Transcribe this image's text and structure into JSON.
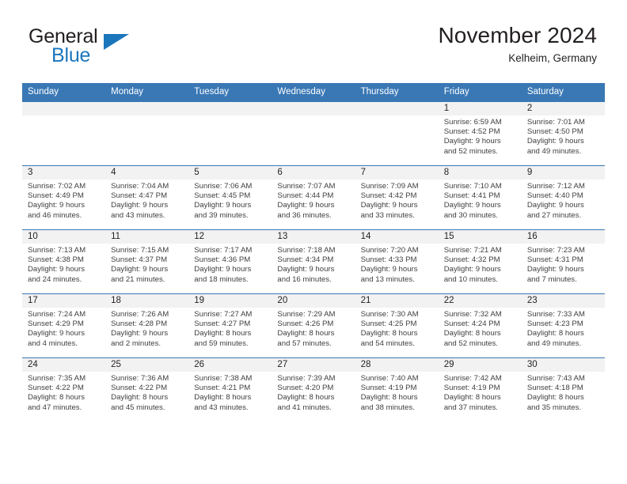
{
  "brand": {
    "name_part1": "General",
    "name_part2": "Blue",
    "logo_icon": "triangle-flag-icon"
  },
  "header": {
    "title": "November 2024",
    "subtitle": "Kelheim, Germany"
  },
  "colors": {
    "header_blue": "#3a78b5",
    "brand_blue": "#1b76bc",
    "daynum_bg": "#f2f2f2",
    "text": "#231f20",
    "detail_text": "#404040"
  },
  "weekdays": [
    "Sunday",
    "Monday",
    "Tuesday",
    "Wednesday",
    "Thursday",
    "Friday",
    "Saturday"
  ],
  "weeks": [
    [
      {
        "day": "",
        "sunrise": "",
        "sunset": "",
        "daylight1": "",
        "daylight2": ""
      },
      {
        "day": "",
        "sunrise": "",
        "sunset": "",
        "daylight1": "",
        "daylight2": ""
      },
      {
        "day": "",
        "sunrise": "",
        "sunset": "",
        "daylight1": "",
        "daylight2": ""
      },
      {
        "day": "",
        "sunrise": "",
        "sunset": "",
        "daylight1": "",
        "daylight2": ""
      },
      {
        "day": "",
        "sunrise": "",
        "sunset": "",
        "daylight1": "",
        "daylight2": ""
      },
      {
        "day": "1",
        "sunrise": "Sunrise: 6:59 AM",
        "sunset": "Sunset: 4:52 PM",
        "daylight1": "Daylight: 9 hours",
        "daylight2": "and 52 minutes."
      },
      {
        "day": "2",
        "sunrise": "Sunrise: 7:01 AM",
        "sunset": "Sunset: 4:50 PM",
        "daylight1": "Daylight: 9 hours",
        "daylight2": "and 49 minutes."
      }
    ],
    [
      {
        "day": "3",
        "sunrise": "Sunrise: 7:02 AM",
        "sunset": "Sunset: 4:49 PM",
        "daylight1": "Daylight: 9 hours",
        "daylight2": "and 46 minutes."
      },
      {
        "day": "4",
        "sunrise": "Sunrise: 7:04 AM",
        "sunset": "Sunset: 4:47 PM",
        "daylight1": "Daylight: 9 hours",
        "daylight2": "and 43 minutes."
      },
      {
        "day": "5",
        "sunrise": "Sunrise: 7:06 AM",
        "sunset": "Sunset: 4:45 PM",
        "daylight1": "Daylight: 9 hours",
        "daylight2": "and 39 minutes."
      },
      {
        "day": "6",
        "sunrise": "Sunrise: 7:07 AM",
        "sunset": "Sunset: 4:44 PM",
        "daylight1": "Daylight: 9 hours",
        "daylight2": "and 36 minutes."
      },
      {
        "day": "7",
        "sunrise": "Sunrise: 7:09 AM",
        "sunset": "Sunset: 4:42 PM",
        "daylight1": "Daylight: 9 hours",
        "daylight2": "and 33 minutes."
      },
      {
        "day": "8",
        "sunrise": "Sunrise: 7:10 AM",
        "sunset": "Sunset: 4:41 PM",
        "daylight1": "Daylight: 9 hours",
        "daylight2": "and 30 minutes."
      },
      {
        "day": "9",
        "sunrise": "Sunrise: 7:12 AM",
        "sunset": "Sunset: 4:40 PM",
        "daylight1": "Daylight: 9 hours",
        "daylight2": "and 27 minutes."
      }
    ],
    [
      {
        "day": "10",
        "sunrise": "Sunrise: 7:13 AM",
        "sunset": "Sunset: 4:38 PM",
        "daylight1": "Daylight: 9 hours",
        "daylight2": "and 24 minutes."
      },
      {
        "day": "11",
        "sunrise": "Sunrise: 7:15 AM",
        "sunset": "Sunset: 4:37 PM",
        "daylight1": "Daylight: 9 hours",
        "daylight2": "and 21 minutes."
      },
      {
        "day": "12",
        "sunrise": "Sunrise: 7:17 AM",
        "sunset": "Sunset: 4:36 PM",
        "daylight1": "Daylight: 9 hours",
        "daylight2": "and 18 minutes."
      },
      {
        "day": "13",
        "sunrise": "Sunrise: 7:18 AM",
        "sunset": "Sunset: 4:34 PM",
        "daylight1": "Daylight: 9 hours",
        "daylight2": "and 16 minutes."
      },
      {
        "day": "14",
        "sunrise": "Sunrise: 7:20 AM",
        "sunset": "Sunset: 4:33 PM",
        "daylight1": "Daylight: 9 hours",
        "daylight2": "and 13 minutes."
      },
      {
        "day": "15",
        "sunrise": "Sunrise: 7:21 AM",
        "sunset": "Sunset: 4:32 PM",
        "daylight1": "Daylight: 9 hours",
        "daylight2": "and 10 minutes."
      },
      {
        "day": "16",
        "sunrise": "Sunrise: 7:23 AM",
        "sunset": "Sunset: 4:31 PM",
        "daylight1": "Daylight: 9 hours",
        "daylight2": "and 7 minutes."
      }
    ],
    [
      {
        "day": "17",
        "sunrise": "Sunrise: 7:24 AM",
        "sunset": "Sunset: 4:29 PM",
        "daylight1": "Daylight: 9 hours",
        "daylight2": "and 4 minutes."
      },
      {
        "day": "18",
        "sunrise": "Sunrise: 7:26 AM",
        "sunset": "Sunset: 4:28 PM",
        "daylight1": "Daylight: 9 hours",
        "daylight2": "and 2 minutes."
      },
      {
        "day": "19",
        "sunrise": "Sunrise: 7:27 AM",
        "sunset": "Sunset: 4:27 PM",
        "daylight1": "Daylight: 8 hours",
        "daylight2": "and 59 minutes."
      },
      {
        "day": "20",
        "sunrise": "Sunrise: 7:29 AM",
        "sunset": "Sunset: 4:26 PM",
        "daylight1": "Daylight: 8 hours",
        "daylight2": "and 57 minutes."
      },
      {
        "day": "21",
        "sunrise": "Sunrise: 7:30 AM",
        "sunset": "Sunset: 4:25 PM",
        "daylight1": "Daylight: 8 hours",
        "daylight2": "and 54 minutes."
      },
      {
        "day": "22",
        "sunrise": "Sunrise: 7:32 AM",
        "sunset": "Sunset: 4:24 PM",
        "daylight1": "Daylight: 8 hours",
        "daylight2": "and 52 minutes."
      },
      {
        "day": "23",
        "sunrise": "Sunrise: 7:33 AM",
        "sunset": "Sunset: 4:23 PM",
        "daylight1": "Daylight: 8 hours",
        "daylight2": "and 49 minutes."
      }
    ],
    [
      {
        "day": "24",
        "sunrise": "Sunrise: 7:35 AM",
        "sunset": "Sunset: 4:22 PM",
        "daylight1": "Daylight: 8 hours",
        "daylight2": "and 47 minutes."
      },
      {
        "day": "25",
        "sunrise": "Sunrise: 7:36 AM",
        "sunset": "Sunset: 4:22 PM",
        "daylight1": "Daylight: 8 hours",
        "daylight2": "and 45 minutes."
      },
      {
        "day": "26",
        "sunrise": "Sunrise: 7:38 AM",
        "sunset": "Sunset: 4:21 PM",
        "daylight1": "Daylight: 8 hours",
        "daylight2": "and 43 minutes."
      },
      {
        "day": "27",
        "sunrise": "Sunrise: 7:39 AM",
        "sunset": "Sunset: 4:20 PM",
        "daylight1": "Daylight: 8 hours",
        "daylight2": "and 41 minutes."
      },
      {
        "day": "28",
        "sunrise": "Sunrise: 7:40 AM",
        "sunset": "Sunset: 4:19 PM",
        "daylight1": "Daylight: 8 hours",
        "daylight2": "and 38 minutes."
      },
      {
        "day": "29",
        "sunrise": "Sunrise: 7:42 AM",
        "sunset": "Sunset: 4:19 PM",
        "daylight1": "Daylight: 8 hours",
        "daylight2": "and 37 minutes."
      },
      {
        "day": "30",
        "sunrise": "Sunrise: 7:43 AM",
        "sunset": "Sunset: 4:18 PM",
        "daylight1": "Daylight: 8 hours",
        "daylight2": "and 35 minutes."
      }
    ]
  ]
}
